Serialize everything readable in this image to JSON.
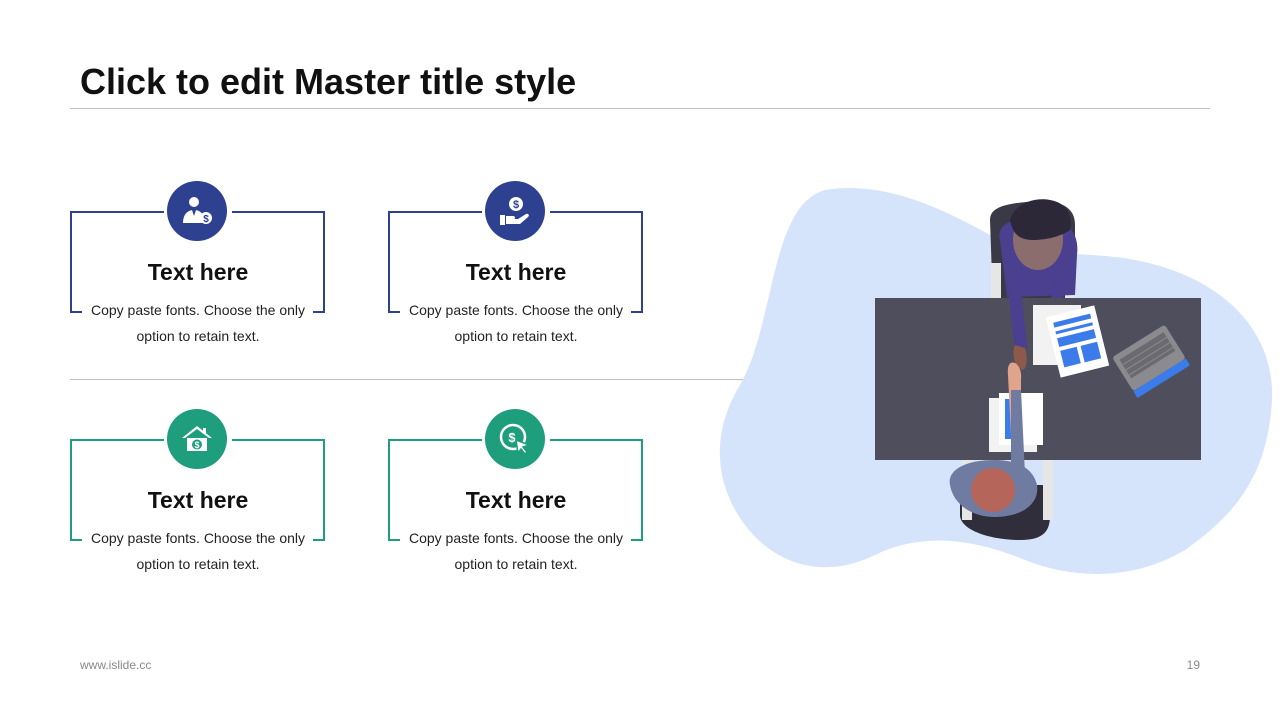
{
  "slide": {
    "title": "Click to edit Master title style",
    "footer_url": "www.islide.cc",
    "page_number": "19"
  },
  "colors": {
    "blue": "#2E4190",
    "green": "#1F9E7E",
    "blob": "#D6E4FB",
    "desk": "#4F4E5C"
  },
  "cards": [
    {
      "title": "Text here",
      "body": "Copy paste fonts. Choose the only option to retain text.",
      "icon": "businessman-dollar-icon"
    },
    {
      "title": "Text here",
      "body": "Copy paste fonts. Choose the only option to retain text.",
      "icon": "hand-coin-icon"
    },
    {
      "title": "Text here",
      "body": "Copy paste fonts. Choose the only option to retain text.",
      "icon": "house-dollar-icon"
    },
    {
      "title": "Text here",
      "body": "Copy paste fonts. Choose the only option to retain text.",
      "icon": "dollar-click-icon"
    }
  ]
}
